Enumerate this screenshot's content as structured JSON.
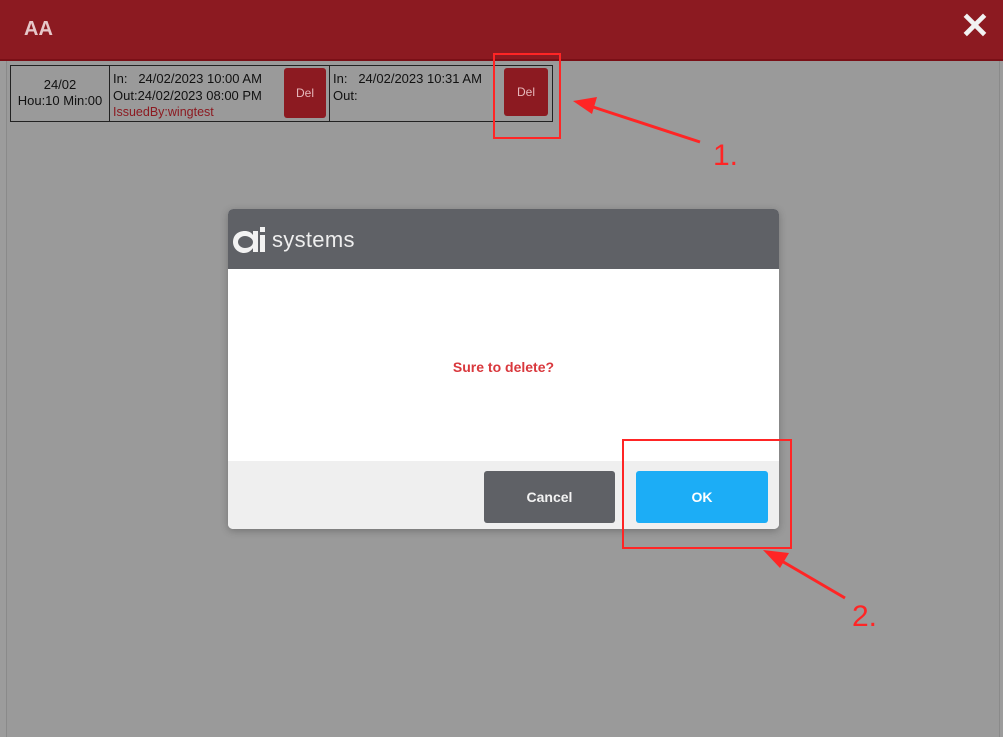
{
  "window": {
    "title": "AA",
    "close_icon": "close-icon"
  },
  "record": {
    "date": "24/02",
    "duration": "Hou:10 Min:00",
    "entry1": {
      "in_label": "In:",
      "in_value": "24/02/2023 10:00 AM",
      "out_text": "Out:24/02/2023 08:00 PM",
      "issued_by": "IssuedBy:wingtest",
      "delete_label": "Del"
    },
    "entry2": {
      "in_label": "In:",
      "in_value": "24/02/2023 10:31 AM",
      "out_text": "Out:",
      "delete_label": "Del"
    }
  },
  "dialog": {
    "brand": "systems",
    "message": "Sure to delete?",
    "cancel_label": "Cancel",
    "ok_label": "OK"
  },
  "annotations": {
    "step1": "1.",
    "step2": "2."
  },
  "colors": {
    "titlebar": "#8c1a21",
    "ok": "#1cadf6",
    "cancel": "#5f6166",
    "message": "#d9383d",
    "annotation": "#ff2525"
  }
}
